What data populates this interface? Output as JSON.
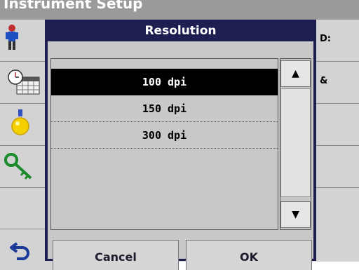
{
  "window": {
    "title": "Instrument Setup"
  },
  "sidebar": {
    "icons": [
      "operator-id-icon",
      "date-time-icon",
      "lamp-icon",
      "security-key-icon"
    ]
  },
  "right_panel": {
    "items": [
      "D:",
      "&"
    ]
  },
  "dialog": {
    "title": "Resolution",
    "options": [
      "100 dpi",
      "150 dpi",
      "300 dpi"
    ],
    "selected_index": 0,
    "cancel_label": "Cancel",
    "ok_label": "OK"
  },
  "scroll": {
    "up_glyph": "▲",
    "down_glyph": "▼"
  },
  "colors": {
    "dialog_header": "#1e1e50",
    "selection": "#000000",
    "panel": "#c8c8c8"
  }
}
